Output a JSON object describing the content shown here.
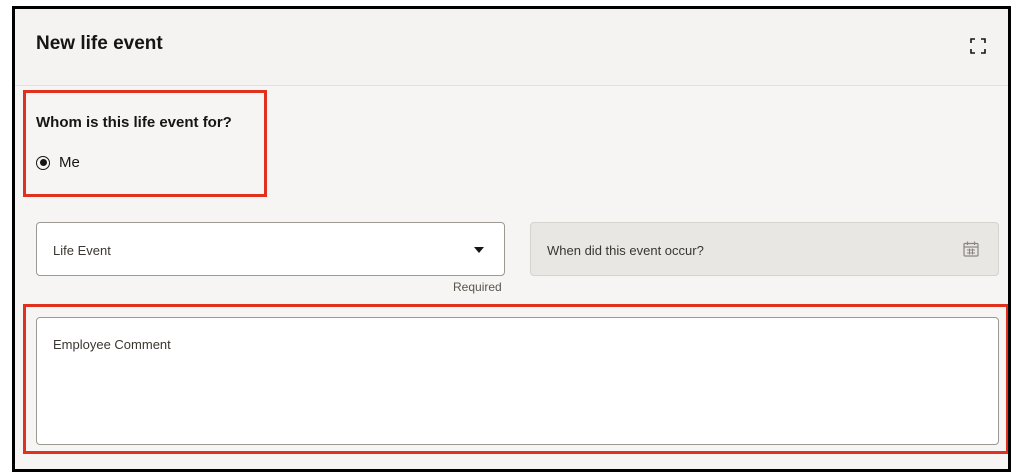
{
  "dialog": {
    "title": "New life event",
    "expand_icon": "expand-icon"
  },
  "who": {
    "question": "Whom is this life event for?",
    "options": [
      {
        "label": "Me",
        "selected": true
      }
    ]
  },
  "form": {
    "life_event": {
      "label": "Life Event",
      "helper": "Required",
      "icon": "chevron-down-icon"
    },
    "event_date": {
      "label": "When did this event occur?",
      "icon": "calendar-icon"
    },
    "employee_comment": {
      "label": "Employee Comment"
    }
  },
  "colors": {
    "highlight": "#e0301e",
    "panel_bg": "#f7f5f3",
    "disabled_field_bg": "#e9e7e3"
  }
}
